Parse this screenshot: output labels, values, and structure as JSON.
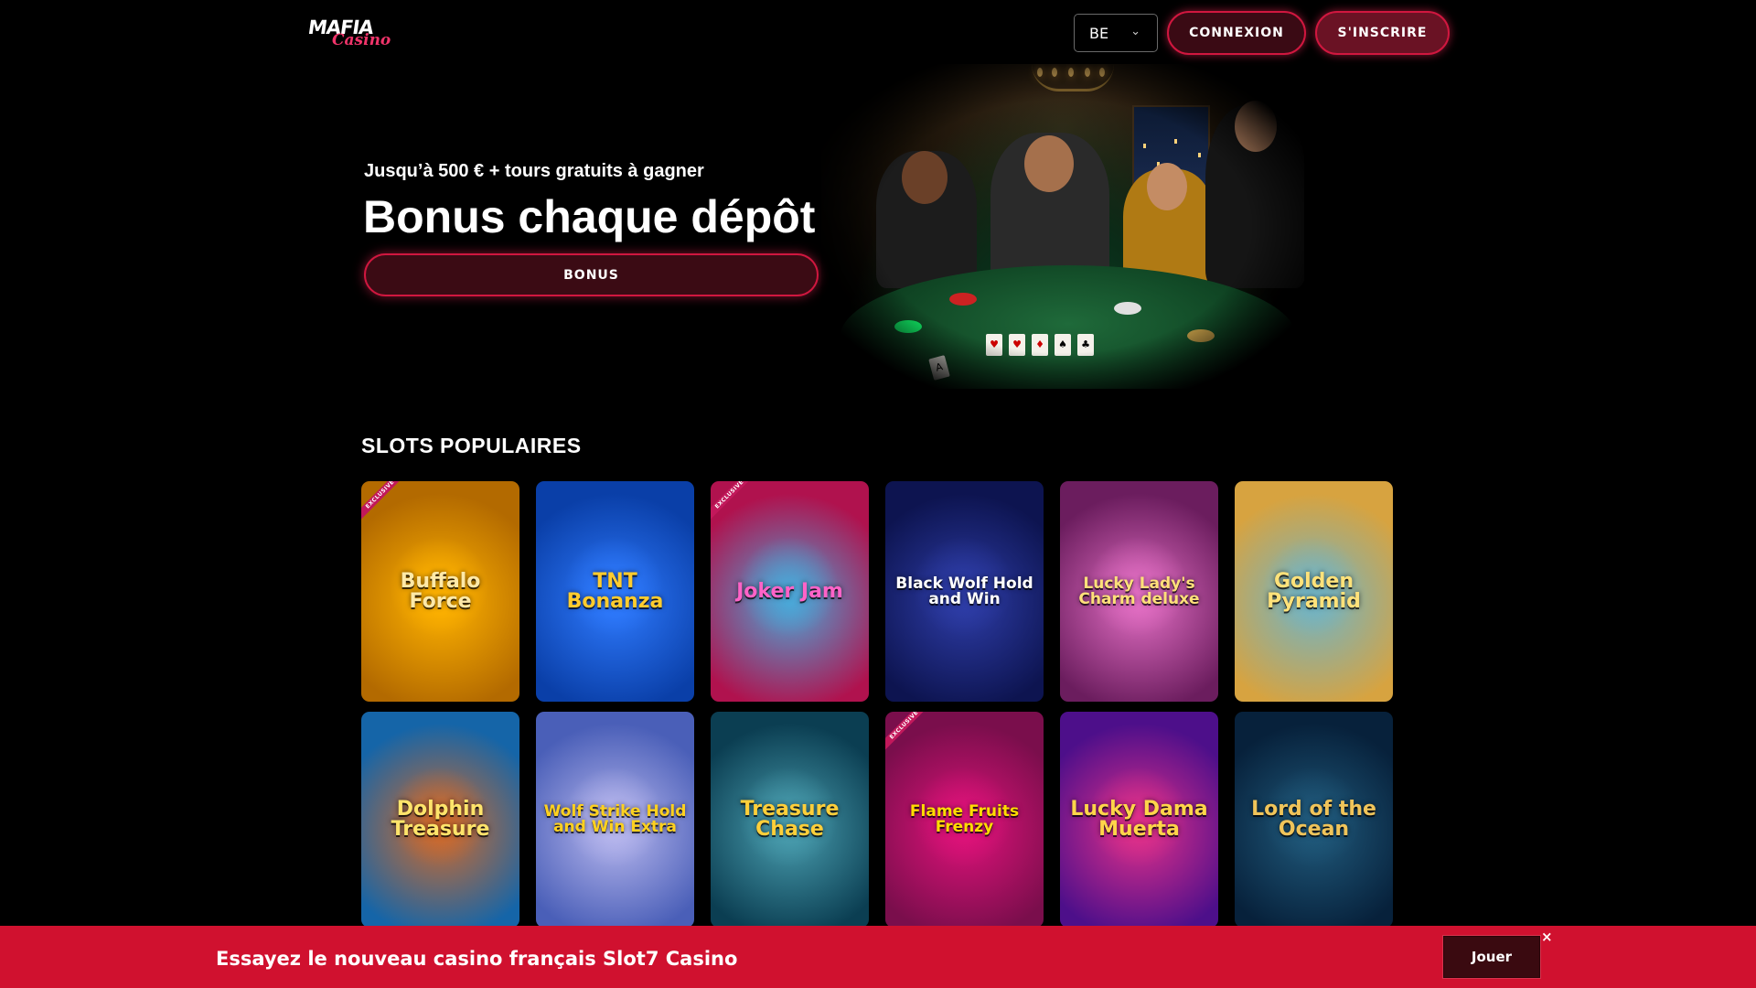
{
  "header": {
    "logo_top": "MAFIA",
    "logo_bottom": "Casino",
    "language": "BE",
    "login_label": "CONNEXION",
    "register_label": "S'INSCRIRE"
  },
  "hero": {
    "subtitle": "Jusqu’à 500 € + tours gratuits à gagner",
    "title": "Bonus chaque dépôt",
    "button_label": "BONUS"
  },
  "slots": {
    "heading": "SLOTS POPULAIRES",
    "exclusive_badge": "EXCLUSIVE",
    "games": [
      {
        "name": "Buffalo Force",
        "colors": [
          "#b36a00",
          "#ffb300"
        ],
        "text_color": "#ffe9a8",
        "exclusive": true
      },
      {
        "name": "TNT Bonanza",
        "colors": [
          "#0a3fa8",
          "#2f7bff"
        ],
        "text_color": "#ffcc2e",
        "exclusive": false
      },
      {
        "name": "Joker Jam",
        "colors": [
          "#b0124e",
          "#4aa8d8"
        ],
        "text_color": "#ff63c8",
        "exclusive": true
      },
      {
        "name": "Black Wolf Hold and Win",
        "colors": [
          "#0d1450",
          "#2e3da8"
        ],
        "text_color": "#ffffff",
        "exclusive": false
      },
      {
        "name": "Lucky Lady's Charm deluxe",
        "colors": [
          "#6b1d5e",
          "#e36fc4"
        ],
        "text_color": "#ffe07a",
        "exclusive": false
      },
      {
        "name": "Golden Pyramid",
        "colors": [
          "#d7a340",
          "#6fb4c7"
        ],
        "text_color": "#ffe27a",
        "exclusive": false
      },
      {
        "name": "Dolphin Treasure",
        "colors": [
          "#1565a8",
          "#d26a2a"
        ],
        "text_color": "#ffe46b",
        "exclusive": false
      },
      {
        "name": "Wolf Strike Hold and Win Extra",
        "colors": [
          "#4a5fb8",
          "#b9b8ee"
        ],
        "text_color": "#ffd11f",
        "exclusive": false
      },
      {
        "name": "Treasure Chase",
        "colors": [
          "#0b3e52",
          "#4a9fb0"
        ],
        "text_color": "#ffcf3a",
        "exclusive": false
      },
      {
        "name": "Flame Fruits Frenzy",
        "colors": [
          "#7a0e4c",
          "#e0127a"
        ],
        "text_color": "#ffdd00",
        "exclusive": true
      },
      {
        "name": "Lucky Dama Muerta",
        "colors": [
          "#4d0f8a",
          "#e2308a"
        ],
        "text_color": "#ffd54a",
        "exclusive": false
      },
      {
        "name": "Lord of the Ocean",
        "colors": [
          "#07213b",
          "#205a7c"
        ],
        "text_color": "#f0c45a",
        "exclusive": false
      }
    ]
  },
  "promo": {
    "text": "Essayez le nouveau casino français Slot7 Casino",
    "button_label": "Jouer",
    "close_icon": "×"
  }
}
